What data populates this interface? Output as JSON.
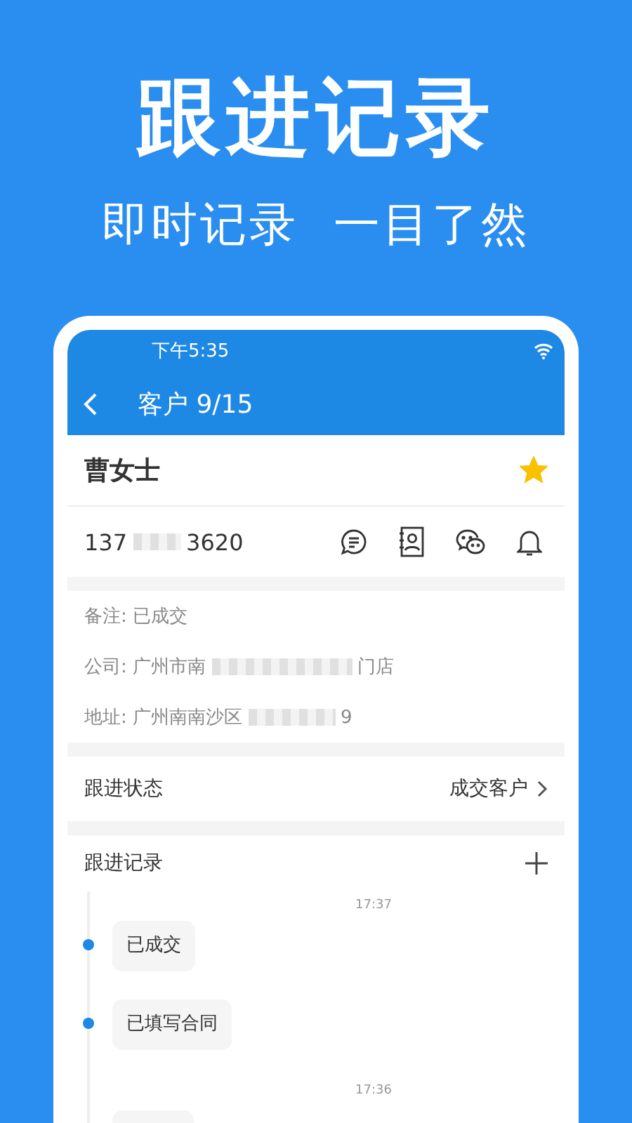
{
  "promo": {
    "title": "跟进记录",
    "subtitle": "即时记录  一目了然"
  },
  "status_bar": {
    "time": "下午5:35"
  },
  "app_bar": {
    "title": "客户 9/15"
  },
  "customer": {
    "name": "曹女士",
    "starred": true,
    "phone_start": "137",
    "phone_end": "3620"
  },
  "details": [
    {
      "label": "备注: 已成交",
      "masked": false
    },
    {
      "label": "公司: 广州市南",
      "masked": true,
      "tail": "门店"
    },
    {
      "label": "地址: 广州南南沙区",
      "masked": true,
      "tail": "9"
    }
  ],
  "follow_status": {
    "label": "跟进状态",
    "value": "成交客户"
  },
  "records": {
    "title": "跟进记录",
    "groups": [
      {
        "time": "17:37",
        "notes": [
          "已成交",
          "已填写合同"
        ]
      },
      {
        "time": "17:36",
        "cut_off_note": true
      }
    ]
  }
}
